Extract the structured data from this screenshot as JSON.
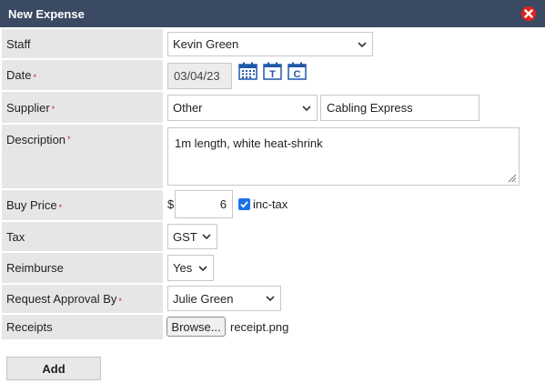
{
  "dialog": {
    "title": "New Expense",
    "close_icon": "close-icon",
    "accent": "#3b4a63"
  },
  "fields": {
    "staff": {
      "label": "Staff",
      "value": "Kevin Green"
    },
    "date": {
      "label": "Date",
      "required_mark": "*",
      "value": "03/04/23",
      "icons": [
        "calendar-icon",
        "today-icon",
        "clear-icon"
      ],
      "today_letter": "T",
      "clear_letter": "C"
    },
    "supplier": {
      "label": "Supplier",
      "required_mark": "*",
      "type_value": "Other",
      "name_value": "Cabling Express"
    },
    "description": {
      "label": "Description",
      "required_mark": "*",
      "value": "1m length, white heat-shrink"
    },
    "buy_price": {
      "label": "Buy Price",
      "required_mark": "*",
      "currency": "$",
      "value": "6",
      "inc_tax_label": "inc-tax",
      "inc_tax_checked": true
    },
    "tax": {
      "label": "Tax",
      "value": "GST"
    },
    "reimburse": {
      "label": "Reimburse",
      "value": "Yes"
    },
    "approval": {
      "label": "Request Approval By",
      "required_mark": "*",
      "value": "Julie Green"
    },
    "receipts": {
      "label": "Receipts",
      "browse_label": "Browse...",
      "file_name": "receipt.png"
    }
  },
  "actions": {
    "add_label": "Add"
  }
}
